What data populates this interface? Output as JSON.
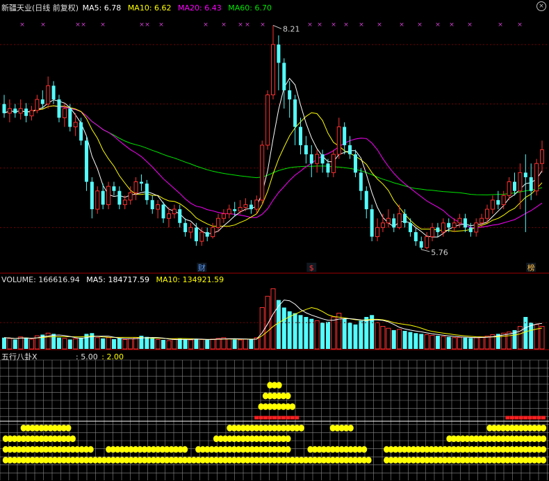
{
  "stock": {
    "name": "新疆天业",
    "period": "(日线 前复权)"
  },
  "colors": {
    "up": "#ff3232",
    "down": "#54fcfc",
    "ma5": "#ffffff",
    "ma10": "#ffff00",
    "ma20": "#ff00ff",
    "ma60": "#00e600",
    "grid": "#7a0000",
    "text": "#c0c0c0",
    "gold": "#ffff00",
    "redDot": "#ff2020",
    "label": "#d0d0d0"
  },
  "price_panel": {
    "legend": [
      {
        "key": "ma5",
        "label": "MA5: 6.78"
      },
      {
        "key": "ma10",
        "label": "MA10: 6.62"
      },
      {
        "key": "ma20",
        "label": "MA20: 6.43"
      },
      {
        "key": "ma60",
        "label": "MA60: 6.70"
      }
    ],
    "high_label": "8.21",
    "low_label": "5.76",
    "markers": [
      {
        "text": "财",
        "color": "#5599ff",
        "bar": 36
      },
      {
        "text": "$",
        "color": "#ff3232",
        "bar": 56
      },
      {
        "text": "榜",
        "color": "#ffbb44",
        "bar": 96
      }
    ]
  },
  "volume_panel": {
    "legend": [
      {
        "key": "vol",
        "label": "VOLUME: 166616.94"
      },
      {
        "key": "ma5",
        "label": "MA5: 184717.59"
      },
      {
        "key": "ma10",
        "label": "MA10: 134921.59"
      }
    ]
  },
  "indicator_panel": {
    "name": "五行八卦X",
    "values": [
      ": 5.00",
      ": 2.00"
    ]
  },
  "chart_data": {
    "type": "candlestick",
    "ylim": [
      5.6,
      8.35
    ],
    "candles": [
      [
        7.35,
        7.25,
        7.45,
        7.2
      ],
      [
        7.25,
        7.3,
        7.4,
        7.15
      ],
      [
        7.3,
        7.25,
        7.35,
        7.2
      ],
      [
        7.25,
        7.3,
        7.4,
        7.18
      ],
      [
        7.3,
        7.22,
        7.36,
        7.15
      ],
      [
        7.22,
        7.28,
        7.33,
        7.17
      ],
      [
        7.28,
        7.4,
        7.45,
        7.25
      ],
      [
        7.4,
        7.35,
        7.5,
        7.3
      ],
      [
        7.35,
        7.55,
        7.65,
        7.3
      ],
      [
        7.55,
        7.4,
        7.6,
        7.35
      ],
      [
        7.4,
        7.2,
        7.45,
        7.15
      ],
      [
        7.2,
        7.3,
        7.35,
        7.1
      ],
      [
        7.3,
        7.1,
        7.35,
        7.05
      ],
      [
        7.1,
        7.15,
        7.25,
        7.0
      ],
      [
        7.15,
        6.95,
        7.2,
        6.9
      ],
      [
        6.95,
        6.5,
        7.0,
        6.4
      ],
      [
        6.5,
        6.2,
        6.55,
        6.1
      ],
      [
        6.2,
        6.4,
        6.45,
        6.15
      ],
      [
        6.4,
        6.25,
        6.48,
        6.2
      ],
      [
        6.25,
        6.45,
        6.5,
        6.2
      ],
      [
        6.45,
        6.4,
        6.5,
        6.35
      ],
      [
        6.4,
        6.25,
        6.45,
        6.2
      ],
      [
        6.25,
        6.3,
        6.35,
        6.2
      ],
      [
        6.3,
        6.38,
        6.45,
        6.25
      ],
      [
        6.38,
        6.5,
        6.55,
        6.3
      ],
      [
        6.5,
        6.48,
        6.58,
        6.4
      ],
      [
        6.48,
        6.3,
        6.52,
        6.25
      ],
      [
        6.3,
        6.2,
        6.35,
        6.15
      ],
      [
        6.2,
        6.25,
        6.3,
        6.1
      ],
      [
        6.25,
        6.1,
        6.28,
        6.05
      ],
      [
        6.1,
        6.15,
        6.22,
        6.0
      ],
      [
        6.15,
        6.2,
        6.25,
        6.1
      ],
      [
        6.2,
        6.05,
        6.25,
        6.0
      ],
      [
        6.05,
        5.95,
        6.1,
        5.9
      ],
      [
        5.95,
        6.0,
        6.05,
        5.88
      ],
      [
        6.0,
        5.85,
        6.05,
        5.8
      ],
      [
        5.85,
        5.95,
        6.0,
        5.8
      ],
      [
        5.95,
        5.9,
        6.0,
        5.85
      ],
      [
        5.9,
        6.0,
        6.05,
        5.88
      ],
      [
        6.0,
        6.1,
        6.15,
        5.95
      ],
      [
        6.1,
        6.15,
        6.2,
        6.05
      ],
      [
        6.15,
        6.2,
        6.25,
        6.1
      ],
      [
        6.2,
        6.18,
        6.28,
        6.12
      ],
      [
        6.18,
        6.22,
        6.3,
        6.15
      ],
      [
        6.22,
        6.25,
        6.32,
        6.18
      ],
      [
        6.25,
        6.2,
        6.3,
        6.15
      ],
      [
        6.2,
        6.3,
        6.35,
        6.15
      ],
      [
        6.3,
        6.9,
        6.95,
        6.25
      ],
      [
        6.9,
        7.45,
        7.5,
        6.85
      ],
      [
        7.45,
        8.0,
        8.21,
        7.4
      ],
      [
        8.0,
        7.8,
        8.1,
        7.5
      ],
      [
        7.8,
        7.5,
        7.85,
        7.3
      ],
      [
        7.5,
        7.4,
        7.6,
        7.2
      ],
      [
        7.4,
        7.1,
        7.45,
        6.9
      ],
      [
        7.1,
        6.9,
        7.2,
        6.8
      ],
      [
        6.9,
        6.8,
        7.0,
        6.7
      ],
      [
        6.8,
        6.7,
        6.9,
        6.55
      ],
      [
        6.7,
        6.8,
        6.85,
        6.6
      ],
      [
        6.8,
        6.7,
        6.85,
        6.6
      ],
      [
        6.7,
        6.6,
        6.75,
        6.55
      ],
      [
        6.6,
        6.8,
        6.85,
        6.55
      ],
      [
        6.8,
        7.1,
        7.2,
        6.75
      ],
      [
        7.1,
        6.9,
        7.15,
        6.8
      ],
      [
        6.9,
        6.8,
        7.0,
        6.75
      ],
      [
        6.8,
        6.6,
        6.85,
        6.55
      ],
      [
        6.6,
        6.4,
        6.65,
        6.3
      ],
      [
        6.4,
        6.2,
        6.45,
        6.1
      ],
      [
        6.2,
        5.9,
        6.25,
        5.85
      ],
      [
        5.9,
        6.0,
        6.1,
        5.85
      ],
      [
        6.0,
        6.05,
        6.15,
        5.95
      ],
      [
        6.05,
        6.1,
        6.2,
        6.0
      ],
      [
        6.1,
        6.0,
        6.15,
        5.95
      ],
      [
        6.0,
        6.15,
        6.25,
        5.98
      ],
      [
        6.15,
        6.05,
        6.2,
        6.0
      ],
      [
        6.05,
        5.95,
        6.1,
        5.9
      ],
      [
        5.95,
        5.85,
        6.0,
        5.8
      ],
      [
        5.85,
        5.78,
        5.9,
        5.76
      ],
      [
        5.78,
        5.9,
        5.95,
        5.76
      ],
      [
        5.9,
        6.0,
        6.05,
        5.85
      ],
      [
        6.0,
        5.95,
        6.05,
        5.9
      ],
      [
        5.95,
        6.05,
        6.1,
        5.9
      ],
      [
        6.05,
        6.0,
        6.1,
        5.95
      ],
      [
        6.0,
        6.05,
        6.1,
        5.95
      ],
      [
        6.05,
        6.1,
        6.15,
        6.0
      ],
      [
        6.1,
        6.0,
        6.15,
        5.95
      ],
      [
        6.0,
        5.95,
        6.05,
        5.9
      ],
      [
        5.95,
        6.05,
        6.1,
        5.9
      ],
      [
        6.05,
        6.1,
        6.15,
        6.0
      ],
      [
        6.1,
        6.2,
        6.25,
        6.05
      ],
      [
        6.2,
        6.3,
        6.35,
        6.15
      ],
      [
        6.3,
        6.25,
        6.4,
        6.2
      ],
      [
        6.25,
        6.35,
        6.4,
        6.2
      ],
      [
        6.35,
        6.5,
        6.55,
        6.3
      ],
      [
        6.5,
        6.4,
        6.6,
        6.35
      ],
      [
        6.4,
        6.6,
        6.7,
        6.2
      ],
      [
        6.6,
        6.55,
        6.8,
        5.95
      ],
      [
        6.55,
        6.4,
        6.7,
        6.3
      ],
      [
        6.4,
        6.7,
        6.75,
        6.35
      ],
      [
        6.7,
        6.85,
        6.95,
        6.6
      ]
    ],
    "volumes": [
      0.3,
      0.28,
      0.25,
      0.32,
      0.3,
      0.26,
      0.35,
      0.38,
      0.42,
      0.4,
      0.3,
      0.28,
      0.25,
      0.27,
      0.3,
      0.4,
      0.42,
      0.3,
      0.28,
      0.3,
      0.26,
      0.28,
      0.25,
      0.27,
      0.3,
      0.35,
      0.32,
      0.28,
      0.25,
      0.24,
      0.22,
      0.26,
      0.28,
      0.26,
      0.24,
      0.27,
      0.25,
      0.24,
      0.26,
      0.28,
      0.3,
      0.27,
      0.25,
      0.24,
      0.26,
      0.25,
      0.3,
      1.1,
      1.4,
      1.6,
      1.3,
      1.1,
      1.0,
      0.95,
      0.9,
      0.85,
      0.8,
      0.75,
      0.7,
      0.72,
      0.85,
      0.95,
      0.8,
      0.7,
      0.65,
      0.75,
      0.85,
      0.9,
      0.7,
      0.6,
      0.55,
      0.5,
      0.52,
      0.48,
      0.45,
      0.42,
      0.4,
      0.38,
      0.36,
      0.35,
      0.33,
      0.32,
      0.3,
      0.31,
      0.3,
      0.29,
      0.3,
      0.32,
      0.34,
      0.38,
      0.4,
      0.42,
      0.45,
      0.5,
      0.6,
      0.85,
      0.7,
      0.65,
      0.6
    ],
    "indicator_rows": [
      {
        "level": 1,
        "segments": [
          [
            0,
            81
          ],
          [
            85,
            120
          ]
        ]
      },
      {
        "level": 2,
        "segments": [
          [
            0,
            19
          ],
          [
            23,
            40
          ],
          [
            43,
            63
          ],
          [
            68,
            80
          ],
          [
            85,
            120
          ]
        ]
      },
      {
        "level": 3,
        "segments": [
          [
            0,
            15
          ],
          [
            47,
            63
          ],
          [
            99,
            120
          ]
        ]
      },
      {
        "level": 4,
        "segments": [
          [
            4,
            14
          ],
          [
            50,
            66
          ],
          [
            73,
            77
          ],
          [
            108,
            120
          ]
        ]
      },
      {
        "level": 5,
        "segments": [
          [
            56,
            65
          ]
        ],
        "red": true
      },
      {
        "level": 5,
        "segments": [
          [
            112,
            120
          ]
        ],
        "red": true
      },
      {
        "level": 6,
        "segments": [
          [
            57,
            64
          ]
        ]
      },
      {
        "level": 7,
        "segments": [
          [
            58,
            63
          ]
        ]
      },
      {
        "level": 8,
        "segments": [
          [
            59,
            61
          ]
        ]
      }
    ]
  }
}
